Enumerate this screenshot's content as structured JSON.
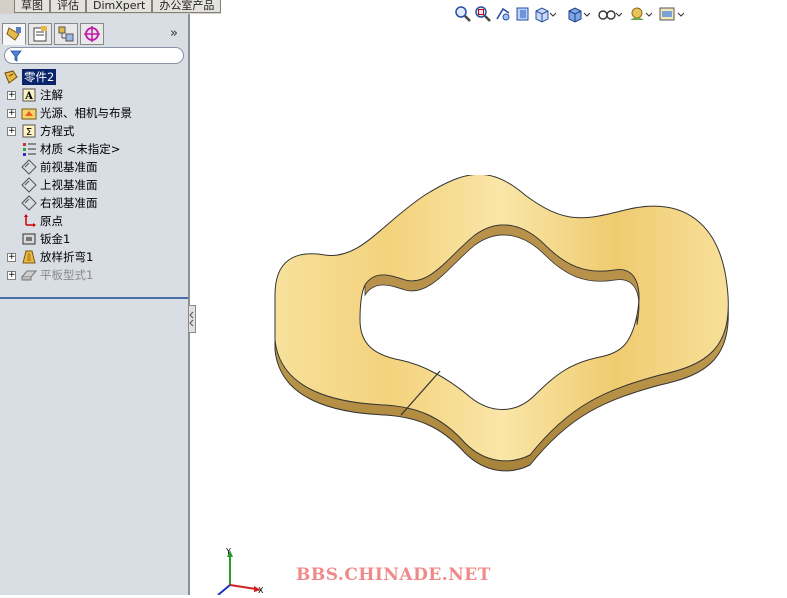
{
  "command_tabs": [
    "草图",
    "评估",
    "DimXpert",
    "办公室产品"
  ],
  "view_toolbar": {
    "icons": [
      "zoom-to-fit-icon",
      "zoom-area-icon",
      "previous-view-icon",
      "section-view-icon",
      "view-orientation-icon",
      "display-style-icon",
      "hide-show-icon",
      "appearance-icon",
      "scene-icon"
    ]
  },
  "panel": {
    "tabs": [
      "feature-manager-icon",
      "property-manager-icon",
      "configuration-manager-icon",
      "dimxpert-manager-icon"
    ],
    "expand": "»"
  },
  "tree": {
    "root": "零件2",
    "items": [
      {
        "label": "注解",
        "icon": "annotations-icon",
        "expandable": true
      },
      {
        "label": "光源、相机与布景",
        "icon": "lights-cameras-icon",
        "expandable": true
      },
      {
        "label": "方程式",
        "icon": "equations-icon",
        "expandable": true
      },
      {
        "label": "材质 <未指定>",
        "icon": "material-icon",
        "expandable": false
      },
      {
        "label": "前视基准面",
        "icon": "plane-icon",
        "expandable": false
      },
      {
        "label": "上视基准面",
        "icon": "plane-icon",
        "expandable": false
      },
      {
        "label": "右视基准面",
        "icon": "plane-icon",
        "expandable": false
      },
      {
        "label": "原点",
        "icon": "origin-icon",
        "expandable": false
      },
      {
        "label": "钣金1",
        "icon": "sheet-metal-icon",
        "expandable": false
      },
      {
        "label": "放样折弯1",
        "icon": "lofted-bend-icon",
        "expandable": true
      },
      {
        "label": "平板型式1",
        "icon": "flat-pattern-icon",
        "expandable": true,
        "suppressed": true
      }
    ]
  },
  "watermark": "BBS.CHINADE.NET",
  "triad": {
    "x": "X",
    "y": "Y"
  },
  "colors": {
    "part_face": "#f4d78a",
    "part_edge": "#c9a657",
    "selection": "#0a246a",
    "watermark": "#f08a8a"
  }
}
